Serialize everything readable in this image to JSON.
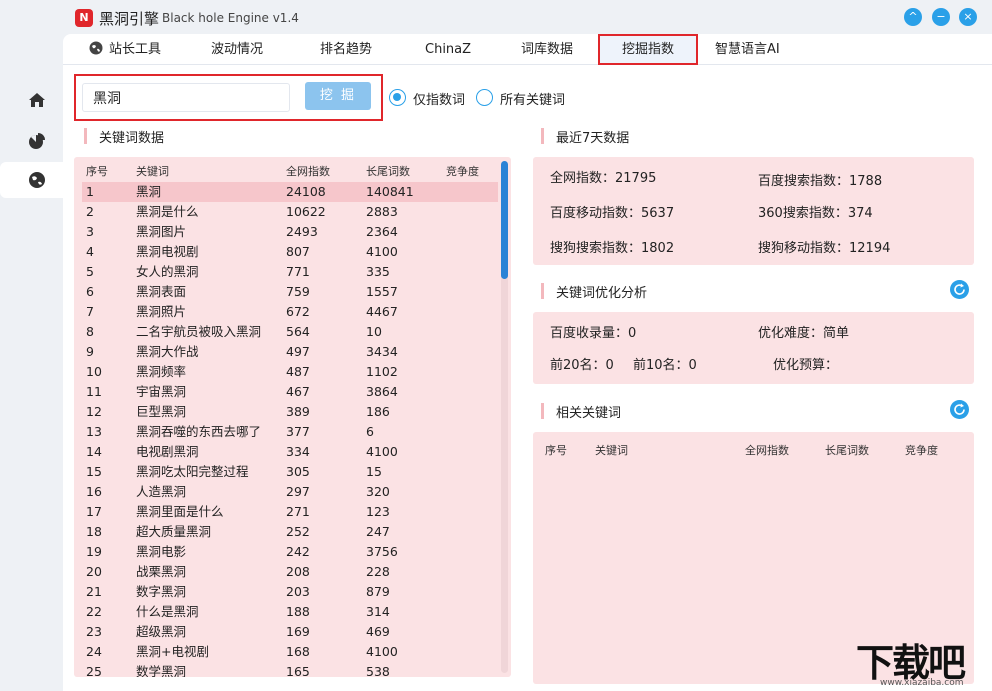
{
  "app": {
    "logo_letter": "N",
    "name": "黑洞引擎",
    "subtitle": "Black hole Engine v1.4",
    "buttons": {
      "up": "^",
      "minimize": "−",
      "close": "×"
    }
  },
  "sidenav": [
    {
      "name": "home",
      "icon": "home-icon"
    },
    {
      "name": "chart",
      "icon": "pie-chart-icon"
    },
    {
      "name": "globe",
      "icon": "globe-icon",
      "active": true
    }
  ],
  "tabs": [
    {
      "label": "站长工具",
      "icon": "globe-icon"
    },
    {
      "label": "波动情况"
    },
    {
      "label": "排名趋势"
    },
    {
      "label": "ChinaZ"
    },
    {
      "label": "词库数据"
    },
    {
      "label": "挖掘指数",
      "active": true
    },
    {
      "label": "智慧语言AI"
    }
  ],
  "search": {
    "value": "黑洞",
    "button": "挖 掘"
  },
  "radios": [
    {
      "label": "仅指数词",
      "checked": true
    },
    {
      "label": "所有关键词",
      "checked": false
    }
  ],
  "keyword_data": {
    "title": "关键词数据",
    "columns": [
      "序号",
      "关键词",
      "全网指数",
      "长尾词数",
      "竞争度"
    ],
    "rows": [
      [
        "1",
        "黑洞",
        "24108",
        "140841"
      ],
      [
        "2",
        "黑洞是什么",
        "10622",
        "2883"
      ],
      [
        "3",
        "黑洞图片",
        "2493",
        "2364"
      ],
      [
        "4",
        "黑洞电视剧",
        "807",
        "4100"
      ],
      [
        "5",
        "女人的黑洞",
        "771",
        "335"
      ],
      [
        "6",
        "黑洞表面",
        "759",
        "1557"
      ],
      [
        "7",
        "黑洞照片",
        "672",
        "4467"
      ],
      [
        "8",
        "二名宇航员被吸入黑洞",
        "564",
        "10"
      ],
      [
        "9",
        "黑洞大作战",
        "497",
        "3434"
      ],
      [
        "10",
        "黑洞频率",
        "487",
        "1102"
      ],
      [
        "11",
        "宇宙黑洞",
        "467",
        "3864"
      ],
      [
        "12",
        "巨型黑洞",
        "389",
        "186"
      ],
      [
        "13",
        "黑洞吞噬的东西去哪了",
        "377",
        "6"
      ],
      [
        "14",
        "电视剧黑洞",
        "334",
        "4100"
      ],
      [
        "15",
        "黑洞吃太阳完整过程",
        "305",
        "15"
      ],
      [
        "16",
        "人造黑洞",
        "297",
        "320"
      ],
      [
        "17",
        "黑洞里面是什么",
        "271",
        "123"
      ],
      [
        "18",
        "超大质量黑洞",
        "252",
        "247"
      ],
      [
        "19",
        "黑洞电影",
        "242",
        "3756"
      ],
      [
        "20",
        "战栗黑洞",
        "208",
        "228"
      ],
      [
        "21",
        "数字黑洞",
        "203",
        "879"
      ],
      [
        "22",
        "什么是黑洞",
        "188",
        "314"
      ],
      [
        "23",
        "超级黑洞",
        "169",
        "469"
      ],
      [
        "24",
        "黑洞+电视剧",
        "168",
        "4100"
      ],
      [
        "25",
        "数学黑洞",
        "165",
        "538"
      ]
    ]
  },
  "recent": {
    "title": "最近7天数据",
    "items": [
      "全网指数：21795",
      "百度搜索指数：1788",
      "百度移动指数：5637",
      "360搜索指数：374",
      "搜狗搜索指数：1802",
      "搜狗移动指数：12194"
    ]
  },
  "optimize": {
    "title": "关键词优化分析",
    "items": [
      "百度收录量：0",
      "优化难度：简单",
      "前20名：0",
      "前10名：0",
      "优化预算："
    ]
  },
  "related": {
    "title": "相关关键词",
    "columns": [
      "序号",
      "关键词",
      "全网指数",
      "长尾词数",
      "竞争度"
    ]
  },
  "watermark": {
    "text": "下载吧",
    "url": "www.xiazaiba.com"
  }
}
